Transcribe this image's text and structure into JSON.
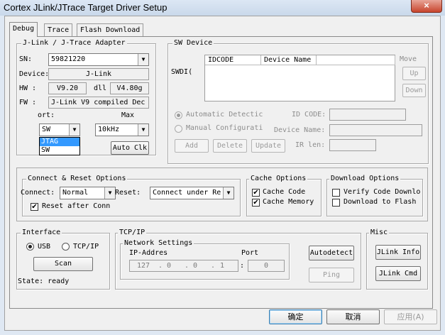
{
  "window": {
    "title": "Cortex JLink/JTrace Target Driver Setup",
    "close_glyph": "×"
  },
  "tabs": [
    "Debug",
    "Trace",
    "Flash Download"
  ],
  "adapter": {
    "title": "J-Link / J-Trace Adapter",
    "sn_label": "SN:",
    "sn_value": "59821220",
    "device_label": "Device:",
    "device_value": "J-Link",
    "hw_label": "HW :",
    "hw_value": "V9.20",
    "dll_label": "dll",
    "dll_value": "V4.80g",
    "fw_label": "FW :",
    "fw_value": "J-Link V9 compiled Dec :",
    "port_label": "ort:",
    "port_value": "SW",
    "port_options": [
      "JTAG",
      "SW"
    ],
    "max_label": "Max",
    "max_value": "10kHz",
    "auto_clk": "Auto Clk"
  },
  "sw_device": {
    "title": "SW Device",
    "swdio_label": "SWDI(",
    "columns": [
      "IDCODE",
      "Device Name"
    ],
    "move_label": "Move",
    "up": "Up",
    "down": "Down",
    "automatic": "Automatic Detectic",
    "manual": "Manual Configurati",
    "id_code_label": "ID CODE:",
    "device_name_label": "Device Name:",
    "ir_len_label": "IR len:",
    "add": "Add",
    "delete": "Delete",
    "update": "Update"
  },
  "connect_reset": {
    "title": "Connect & Reset Options",
    "connect_label": "Connect:",
    "connect_value": "Normal",
    "reset_label": "Reset:",
    "reset_value": "Connect under Re",
    "reset_after_connect": "Reset after Conn"
  },
  "cache": {
    "title": "Cache Options",
    "code": "Cache Code",
    "memory": "Cache Memory"
  },
  "download": {
    "title": "Download Options",
    "verify": "Verify Code Downlo",
    "to_flash": "Download to Flash"
  },
  "interface": {
    "title": "Interface",
    "usb": "USB",
    "tcpip": "TCP/IP",
    "scan": "Scan",
    "state": "State: ready"
  },
  "tcpip": {
    "title": "TCP/IP",
    "network_settings": "Network Settings",
    "ip_label": "IP-Addres",
    "ip_octets": [
      "127",
      "0",
      "0",
      "1"
    ],
    "ip_dots": [
      ".",
      ".",
      "."
    ],
    "port_label": "Port",
    "port_sep": ":",
    "port_value": "0",
    "autodetect": "Autodetect",
    "ping": "Ping"
  },
  "misc": {
    "title": "Misc",
    "jlink_info": "JLink Info",
    "jlink_cmd": "JLink Cmd"
  },
  "footer": {
    "ok": "确定",
    "cancel": "取消",
    "apply": "应用(A)"
  },
  "icons": {
    "check": "✔",
    "combo_arrow": "▼"
  }
}
